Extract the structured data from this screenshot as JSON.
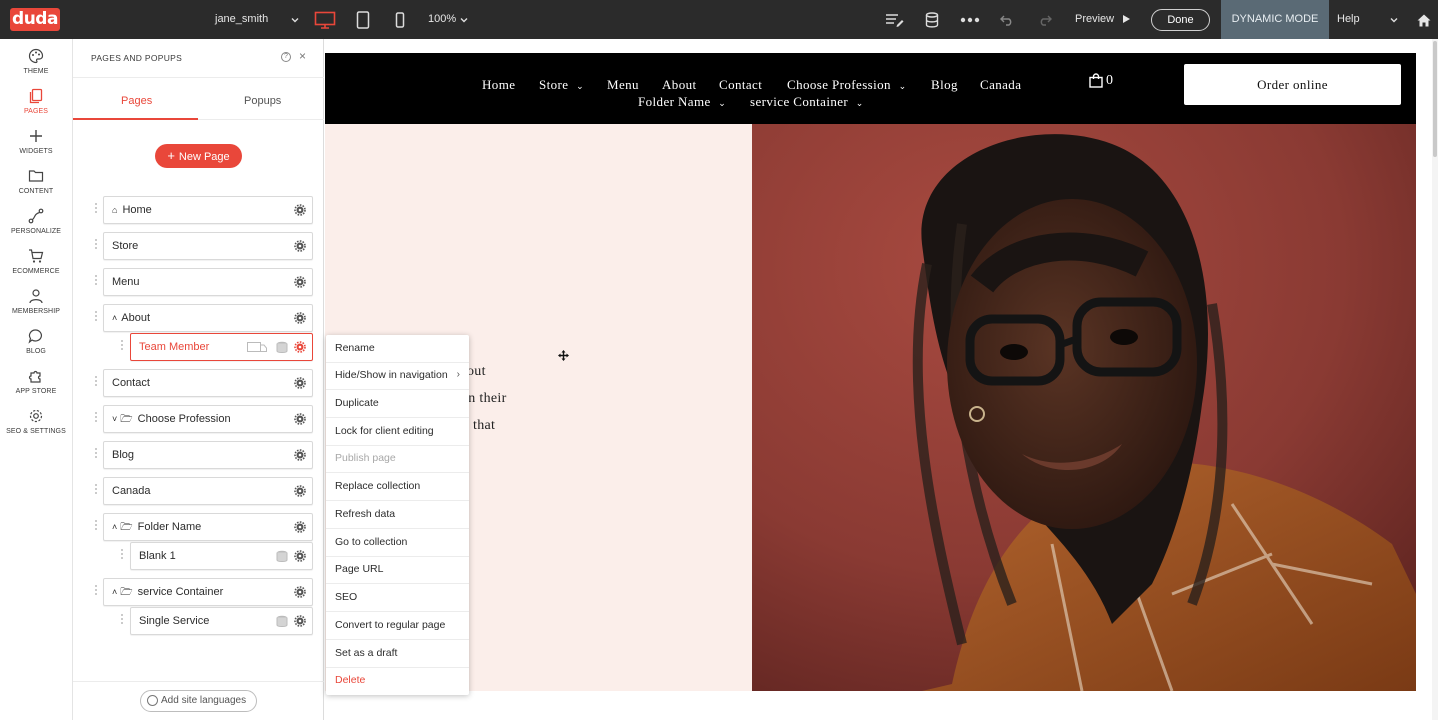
{
  "topbar": {
    "logo": "duda",
    "user": "jane_smith",
    "zoom": "100%",
    "preview_label": "Preview",
    "done_label": "Done",
    "dynamic_mode_label": "DYNAMIC MODE",
    "help_label": "Help"
  },
  "rail": {
    "items": [
      {
        "label": "THEME",
        "icon": "palette-icon"
      },
      {
        "label": "PAGES",
        "icon": "pages-icon"
      },
      {
        "label": "WIDGETS",
        "icon": "plus-icon"
      },
      {
        "label": "CONTENT",
        "icon": "folder-icon"
      },
      {
        "label": "PERSONALIZE",
        "icon": "personalize-icon"
      },
      {
        "label": "ECOMMERCE",
        "icon": "cart-icon"
      },
      {
        "label": "MEMBERSHIP",
        "icon": "user-icon"
      },
      {
        "label": "BLOG",
        "icon": "chat-icon"
      },
      {
        "label": "APP STORE",
        "icon": "puzzle-icon"
      },
      {
        "label": "SEO & SETTINGS",
        "icon": "gear-icon"
      }
    ]
  },
  "panel": {
    "title": "PAGES AND POPUPS",
    "tabs": [
      "Pages",
      "Popups"
    ],
    "new_page_label": "New Page",
    "pages": [
      {
        "label": "Home",
        "level": 0,
        "icon": "home-icon"
      },
      {
        "label": "Store",
        "level": 0
      },
      {
        "label": "Menu",
        "level": 0
      },
      {
        "label": "About",
        "level": 0,
        "expanded": true
      },
      {
        "label": "Team Member",
        "level": 1,
        "selected": true,
        "dynamic": true
      },
      {
        "label": "Contact",
        "level": 0
      },
      {
        "label": "Choose Profession",
        "level": 0,
        "folder": true
      },
      {
        "label": "Blog",
        "level": 0
      },
      {
        "label": "Canada",
        "level": 0
      },
      {
        "label": "Folder Name",
        "level": 0,
        "folder": true,
        "expanded": true
      },
      {
        "label": "Blank 1",
        "level": 1,
        "dynamic": true
      },
      {
        "label": "service Container",
        "level": 0,
        "folder": true,
        "expanded": true
      },
      {
        "label": "Single Service",
        "level": 1,
        "dynamic": true
      }
    ],
    "languages_label": "Add site languages"
  },
  "site": {
    "nav": [
      "Home",
      "Store",
      "Menu",
      "About",
      "Contact",
      "Choose Profession",
      "Blog",
      "Canada",
      "Folder Name",
      "service Container"
    ],
    "cart_count": "0",
    "order_label": "Order online",
    "hero_lines": [
      "out",
      "on their",
      "that"
    ]
  },
  "context_menu": {
    "items": [
      {
        "label": "Rename"
      },
      {
        "label": "Hide/Show in navigation",
        "submenu": true
      },
      {
        "label": "Duplicate"
      },
      {
        "label": "Lock for client editing"
      },
      {
        "label": "Publish page",
        "disabled": true
      },
      {
        "label": "Replace collection"
      },
      {
        "label": "Refresh data"
      },
      {
        "label": "Go to collection"
      },
      {
        "label": "Page URL"
      },
      {
        "label": "SEO"
      },
      {
        "label": "Convert to regular page"
      },
      {
        "label": "Set as a draft"
      },
      {
        "label": "Delete",
        "danger": true
      }
    ]
  },
  "colors": {
    "brand": "#e9473a",
    "topbar": "#2b2b2b",
    "dynamic_mode": "#5a6a75",
    "hero_bg": "#fbeeea"
  }
}
